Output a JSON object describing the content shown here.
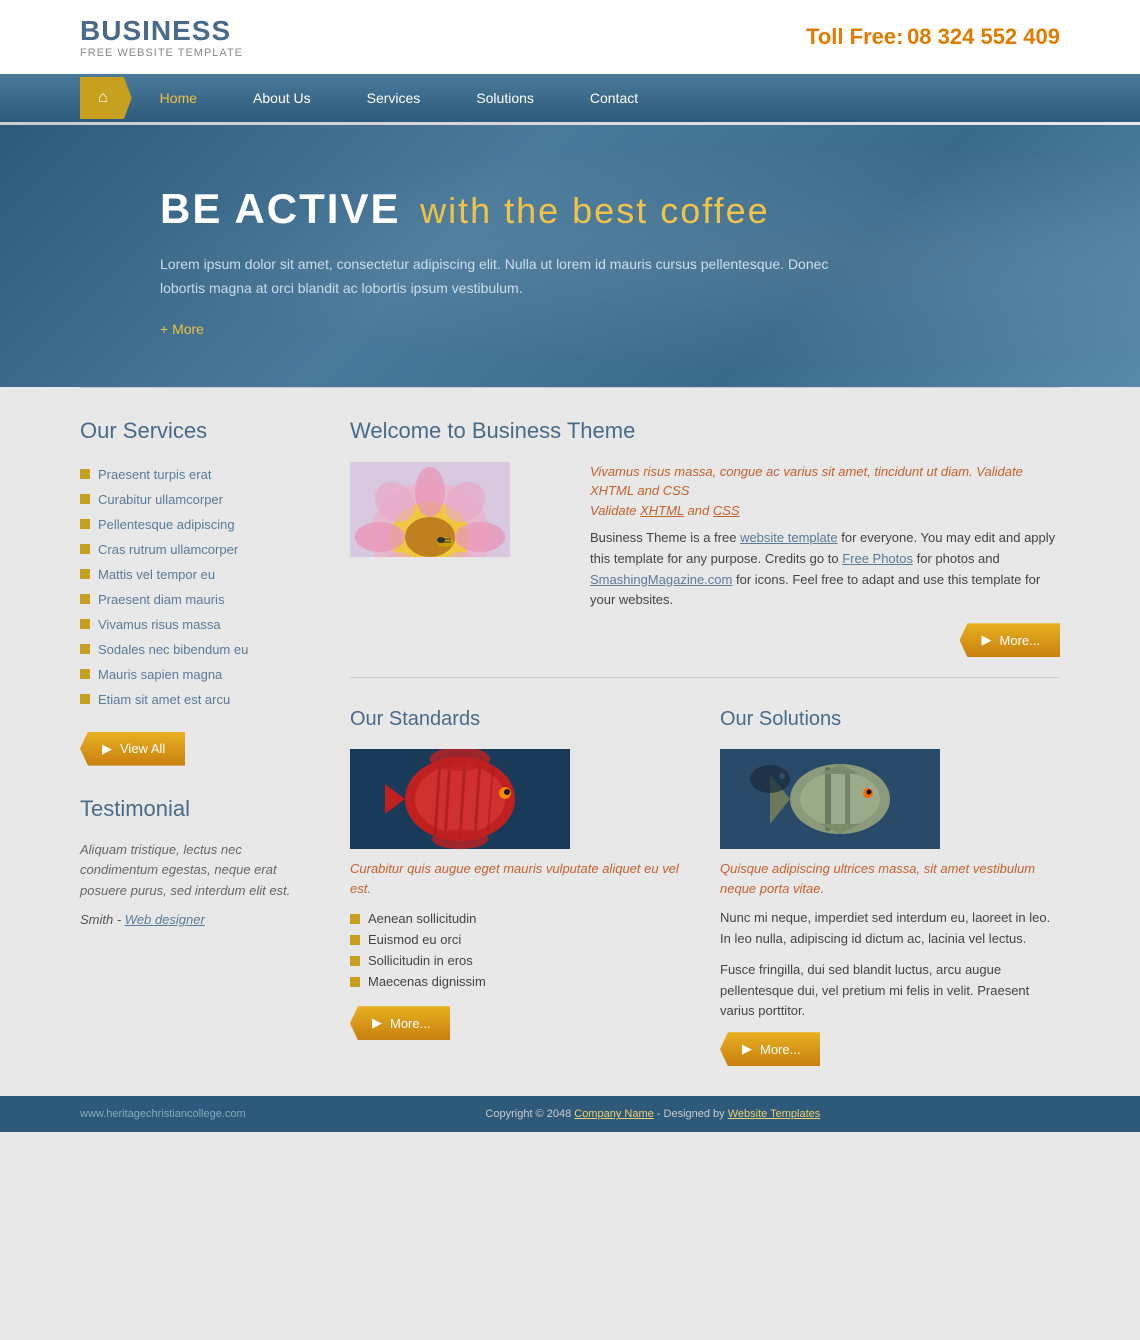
{
  "header": {
    "brand_title": "BUSINESS",
    "brand_sub": "FREE WEBSITE TEMPLATE",
    "toll_free_label": "Toll Free:",
    "toll_free_number": "08 324 552 409"
  },
  "nav": {
    "home_label": "Home",
    "links": [
      {
        "label": "Home",
        "active": true
      },
      {
        "label": "About Us"
      },
      {
        "label": "Services"
      },
      {
        "label": "Solutions"
      },
      {
        "label": "Contact"
      }
    ]
  },
  "hero": {
    "title_main": "BE ACTIVE",
    "title_sub": "with the best coffee",
    "body": "Lorem ipsum dolor sit amet, consectetur adipiscing elit. Nulla ut lorem id mauris cursus pellentesque. Donec lobortis magna at orci blandit ac lobortis ipsum vestibulum.",
    "more_label": "+ More"
  },
  "services": {
    "title": "Our Services",
    "items": [
      "Praesent turpis erat",
      "Curabitur ullamcorper",
      "Pellentesque adipiscing",
      "Cras rutrum ullamcorper",
      "Mattis vel tempor eu",
      "Praesent diam mauris",
      "Vivamus risus massa",
      "Sodales nec bibendum eu",
      "Mauris sapien magna",
      "Etiam sit amet est arcu"
    ],
    "view_all_label": "View All"
  },
  "testimonial": {
    "title": "Testimonial",
    "text": "Aliquam tristique, lectus nec condimentum egestas, neque erat posuere purus, sed interdum elit est.",
    "author": "Smith",
    "author_role": "Web designer"
  },
  "welcome": {
    "title": "Welcome to Business Theme",
    "highlight": "Vivamus risus massa, congue ac varius sit amet, tincidunt ut diam. Validate XHTML and CSS",
    "desc": "Business Theme is a free website template for everyone. You may edit and apply this template for any purpose. Credits go to Free Photos for photos and SmashingMagazine.com for icons. Feel free to adapt and use this template for your websites.",
    "more_label": "More..."
  },
  "standards": {
    "title": "Our Standards",
    "caption": "Curabitur quis augue eget mauris vulputate aliquet eu vel est.",
    "items": [
      "Aenean sollicitudin",
      "Euismod eu orci",
      "Sollicitudin in eros",
      "Maecenas dignissim"
    ],
    "more_label": "More..."
  },
  "solutions": {
    "title": "Our Solutions",
    "caption": "Quisque adipiscing ultrices massa, sit amet vestibulum neque porta vitae.",
    "para1": "Nunc mi neque, imperdiet sed interdum eu, laoreet in leo. In leo nulla, adipiscing id dictum ac, lacinia vel lectus.",
    "para2": "Fusce fringilla, dui sed blandit luctus, arcu augue pellentesque dui, vel pretium mi felis in velit. Praesent varius porttitor.",
    "more_label": "More..."
  },
  "footer": {
    "url": "www.heritagechristiancollege.com",
    "copyright": "Copyright © 2048",
    "company_link": "Company Name",
    "designed_by": "Designed by",
    "template_link": "Website Templates"
  }
}
